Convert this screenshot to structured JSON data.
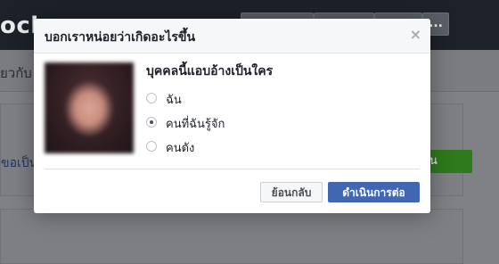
{
  "background": {
    "topbar_text": "ocha",
    "more_label": "...",
    "subbar_text": "ยวกับ",
    "card_link_text": "ขอเป็น",
    "green_button_label": "น"
  },
  "dialog": {
    "title": "บอกเราหน่อยว่าเกิดอะไรขึ้น",
    "close_label": "×",
    "question": "บุคคลนี้แอบอ้างเป็นใคร",
    "options": [
      {
        "label": "ฉัน",
        "checked": false
      },
      {
        "label": "คนที่ฉันรู้จัก",
        "checked": true
      },
      {
        "label": "คนดัง",
        "checked": false
      }
    ],
    "back_label": "ย้อนกลับ",
    "continue_label": "ดำเนินการต่อ"
  },
  "colors": {
    "accent": "#4267b2",
    "overlay": "#7f8184",
    "topbar": "#1d2129"
  }
}
